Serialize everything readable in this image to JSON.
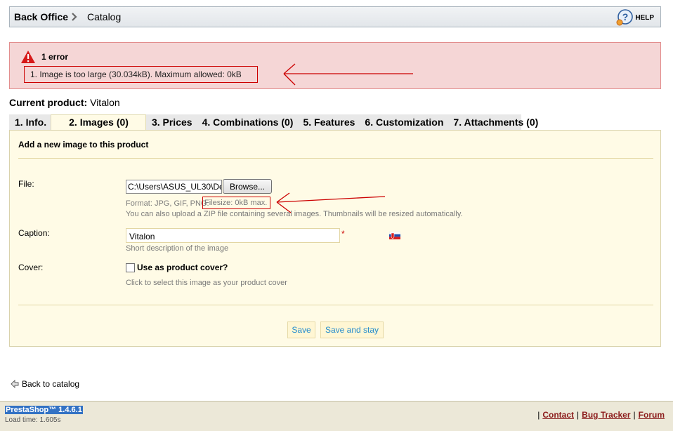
{
  "breadcrumb": {
    "root": "Back Office",
    "current": "Catalog"
  },
  "help": {
    "label": "HELP"
  },
  "error": {
    "title": "1 error",
    "items": [
      "1.  Image is too large (30.034kB). Maximum allowed: 0kB"
    ]
  },
  "product": {
    "label": "Current product:",
    "name": "Vitalon"
  },
  "tabs": [
    {
      "label": "1. Info."
    },
    {
      "label": "2. Images (0)",
      "active": true
    },
    {
      "label": "3. Prices"
    },
    {
      "label": "4. Combinations (0)"
    },
    {
      "label": "5. Features"
    },
    {
      "label": "6. Customization"
    },
    {
      "label": "7. Attachments (0)"
    }
  ],
  "form": {
    "heading": "Add a new image to this product",
    "file_label": "File:",
    "file_value": "C:\\Users\\ASUS_UL30\\De",
    "browse_label": "Browse...",
    "format_hint": "Format: JPG, GIF, PNG.",
    "filesize_hint": "Filesize: 0kB max.",
    "zip_hint": "You can also upload a ZIP file containing several images. Thumbnails will be resized automatically.",
    "caption_label": "Caption:",
    "caption_value": "Vitalon",
    "required_mark": "*",
    "caption_hint": "Short description of the image",
    "cover_label": "Cover:",
    "cover_checkbox_label": "Use as product cover?",
    "cover_checked": false,
    "cover_hint": "Click to select this image as your product cover",
    "save_label": "Save",
    "save_stay_label": "Save and stay"
  },
  "back_link": "Back to catalog",
  "footer": {
    "brand": "PrestaShop™ 1.4.6.1",
    "load_time": "Load time: 1.605s",
    "sep": "|",
    "links": [
      "Contact",
      "Bug Tracker",
      "Forum"
    ]
  },
  "colors": {
    "error_bg": "#f5d6d6",
    "panel_bg": "#fffbe6",
    "button_text": "#268ccd",
    "annotation": "#cc0000"
  }
}
